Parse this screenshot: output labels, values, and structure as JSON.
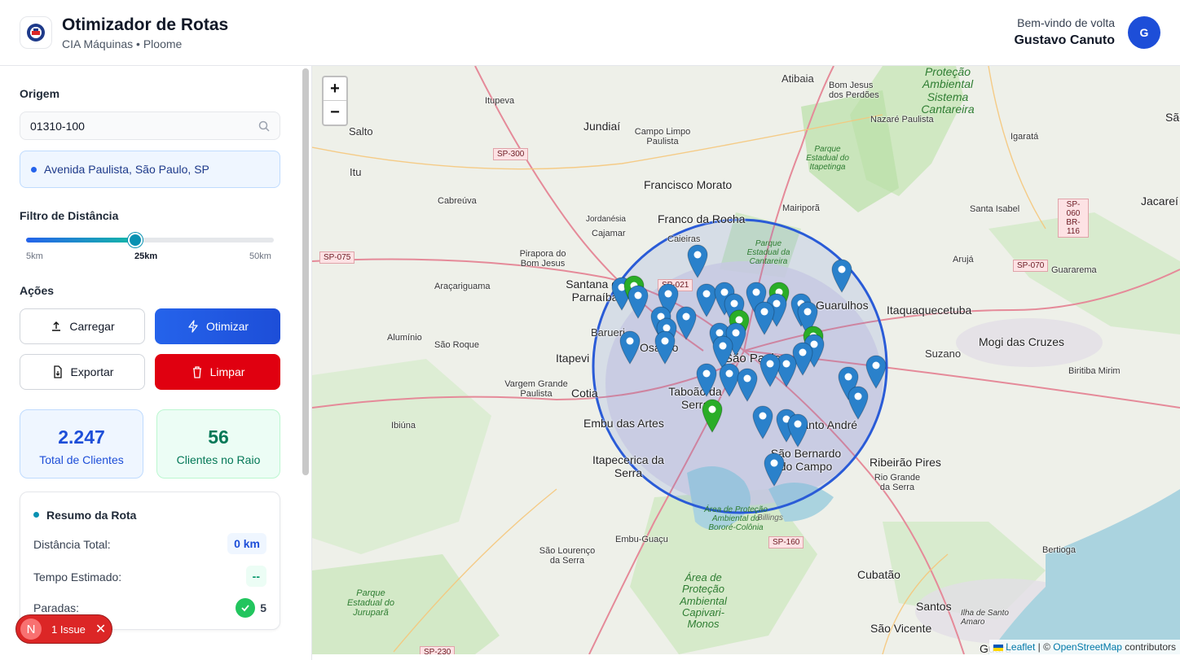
{
  "header": {
    "title": "Otimizador de Rotas",
    "subtitle": "CIA Máquinas • Ploome",
    "welcome": "Bem-vindo de volta",
    "username": "Gustavo Canuto",
    "avatar_initial": "G"
  },
  "sidebar": {
    "origin_label": "Origem",
    "search_value": "01310-100",
    "address": "Avenida Paulista, São Paulo, SP",
    "distance_label": "Filtro de Distância",
    "slider": {
      "min_label": "5km",
      "current_label": "25km",
      "max_label": "50km",
      "value_fraction": 0.44
    },
    "actions_label": "Ações",
    "buttons": {
      "load": "Carregar",
      "optimize": "Otimizar",
      "export": "Exportar",
      "clear": "Limpar"
    },
    "stats": {
      "total_value": "2.247",
      "total_label": "Total de Clientes",
      "radius_value": "56",
      "radius_label": "Clientes no Raio"
    },
    "summary": {
      "title": "Resumo da Rota",
      "distance_label": "Distância Total:",
      "distance_value": "0 km",
      "time_label": "Tempo Estimado:",
      "time_value": "--",
      "stops_label": "Paradas:",
      "stops_value": "5"
    },
    "issue": {
      "initial": "N",
      "text": "1 Issue"
    }
  },
  "map": {
    "zoom_in": "+",
    "zoom_out": "−",
    "attribution_leaflet": "Leaflet",
    "attribution_sep": " | © ",
    "attribution_osm": "OpenStreetMap",
    "attribution_tail": " contributors",
    "places": {
      "atibaia": "Atibaia",
      "bom_jesus": "Bom Jesus dos Perdões",
      "itupeva": "Itupeva",
      "jundiai": "Jundiaí",
      "salto": "Salto",
      "campo_limpo": "Campo Limpo Paulista",
      "nazare": "Nazaré Paulista",
      "igarata": "Igaratá",
      "itu": "Itu",
      "francisco_morato": "Francisco Morato",
      "cabreuva": "Cabreúva",
      "franco_rocha": "Franco da Rocha",
      "mairipora": "Mairiporã",
      "santa_isabel": "Santa Isabel",
      "jacarei": "Jacareí",
      "jordanesia": "Jordanésia",
      "cajamar": "Cajamar",
      "caieiras": "Caieiras",
      "pirapora": "Pirapora do Bom Jesus",
      "santana": "Santana de Parnaíba",
      "guarulhos": "Guarulhos",
      "itaquaquecetuba": "Itaquaquecetuba",
      "aruja": "Arujá",
      "guararema": "Guararema",
      "araçariguama": "Araçariguama",
      "barueri": "Barueri",
      "osasco": "Osasco",
      "sao_paulo": "São Paulo",
      "mogi": "Mogi das Cruzes",
      "aluminio": "Alumínio",
      "sao_roque": "São Roque",
      "itapevi": "Itapevi",
      "suzano": "Suzano",
      "vargem": "Vargem Grande Paulista",
      "cotia": "Cotia",
      "taboao": "Taboão da Serra",
      "biritiba": "Biritiba Mirim",
      "ibiuna": "Ibiúna",
      "embu": "Embu das Artes",
      "santo_andre": "Santo André",
      "itapecerica": "Itapecerica da Serra",
      "sbc": "São Bernardo do Campo",
      "ribeirao_pires": "Ribeirão Pires",
      "rio_grande": "Rio Grande da Serra",
      "embu_guacu": "Embu-Guaçu",
      "sao_lourenco": "São Lourenço da Serra",
      "bertioga": "Bertioga",
      "cubatao": "Cubatão",
      "santos": "Santos",
      "sao_vicente": "São Vicente",
      "guaruja": "Guaru",
      "ilha": "Ilha de Santo Amaro",
      "sao": "São"
    },
    "roads": [
      "SP-300",
      "SP-075",
      "SP-021",
      "SP-070",
      "SP-060 BR-116",
      "SP-160",
      "SP-230"
    ],
    "green_areas": {
      "cantareira": "Proteção Ambiental Sistema Cantareira",
      "itapetinga": "Parque Estadual do Itapetinga",
      "estadual_cantareira": "Parque Estadual da Cantareira",
      "capivari": "Área de Proteção Ambiental Capivari-Monos",
      "bororé": "Área de Proteção Ambiental do Bororé-Colônia",
      "jurupara": "Parque Estadual do Juruparã",
      "billings": "Billings"
    },
    "colors": {
      "radius_circle": "#2a5bd7",
      "marker_blue": "#2a81cb",
      "marker_green": "#2aad27"
    }
  }
}
